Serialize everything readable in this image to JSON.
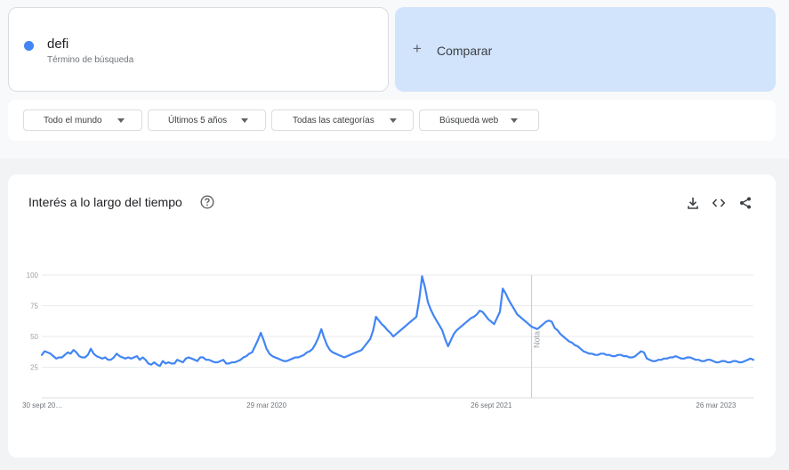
{
  "term": {
    "name": "defi",
    "subtitle": "Término de búsqueda",
    "color": "#4285f4"
  },
  "compare": {
    "label": "Comparar"
  },
  "filters": [
    {
      "label": "Todo el mundo"
    },
    {
      "label": "Últimos 5 años"
    },
    {
      "label": "Todas las categorías"
    },
    {
      "label": "Búsqueda web"
    }
  ],
  "chart": {
    "title": "Interés a lo largo del tiempo",
    "note_label": "Nota",
    "icons": [
      "help-icon",
      "download-icon",
      "embed-icon",
      "share-icon"
    ]
  },
  "chart_data": {
    "type": "line",
    "x_labels": [
      "30 sept 20…",
      "29 mar 2020",
      "26 sept 2021",
      "26 mar 2023"
    ],
    "x_label_weeks": [
      0,
      78,
      156,
      234
    ],
    "yticks": [
      25,
      50,
      75,
      100
    ],
    "ylim": [
      0,
      100
    ],
    "grid": true,
    "note_week": 170,
    "series": [
      {
        "color": "#4285f4",
        "values": [
          35,
          38,
          37,
          36,
          34,
          32,
          33,
          33,
          35,
          37,
          36,
          39,
          37,
          34,
          33,
          33,
          35,
          40,
          36,
          34,
          33,
          32,
          33,
          31,
          31,
          33,
          36,
          34,
          33,
          32,
          33,
          32,
          33,
          34,
          31,
          33,
          31,
          28,
          27,
          29,
          27,
          26,
          30,
          28,
          29,
          28,
          28,
          31,
          30,
          29,
          32,
          33,
          32,
          31,
          30,
          33,
          33,
          31,
          31,
          30,
          29,
          29,
          30,
          31,
          28,
          28,
          29,
          29,
          30,
          31,
          33,
          34,
          36,
          37,
          42,
          47,
          53,
          47,
          40,
          36,
          34,
          33,
          32,
          31,
          30,
          30,
          31,
          32,
          33,
          33,
          34,
          35,
          37,
          38,
          40,
          44,
          49,
          56,
          49,
          43,
          39,
          37,
          36,
          35,
          34,
          33,
          34,
          35,
          36,
          37,
          38,
          39,
          42,
          45,
          48,
          55,
          66,
          63,
          60,
          58,
          55,
          53,
          50,
          52,
          54,
          56,
          58,
          60,
          62,
          64,
          66,
          80,
          99,
          90,
          78,
          72,
          67,
          63,
          59,
          55,
          48,
          42,
          47,
          52,
          55,
          57,
          59,
          61,
          63,
          65,
          66,
          68,
          71,
          70,
          67,
          64,
          62,
          60,
          65,
          70,
          89,
          85,
          80,
          76,
          72,
          68,
          66,
          64,
          62,
          60,
          58,
          57,
          56,
          58,
          60,
          62,
          63,
          62,
          57,
          55,
          52,
          50,
          48,
          46,
          45,
          43,
          42,
          40,
          38,
          37,
          36,
          36,
          35,
          35,
          36,
          36,
          35,
          35,
          34,
          34,
          35,
          35,
          34,
          34,
          33,
          33,
          34,
          36,
          38,
          37,
          32,
          31,
          30,
          30,
          31,
          31,
          32,
          32,
          33,
          33,
          34,
          33,
          32,
          32,
          33,
          33,
          32,
          31,
          31,
          30,
          30,
          31,
          31,
          30,
          29,
          29,
          30,
          30,
          29,
          29,
          30,
          30,
          29,
          29,
          30,
          31,
          32,
          31
        ]
      }
    ]
  }
}
